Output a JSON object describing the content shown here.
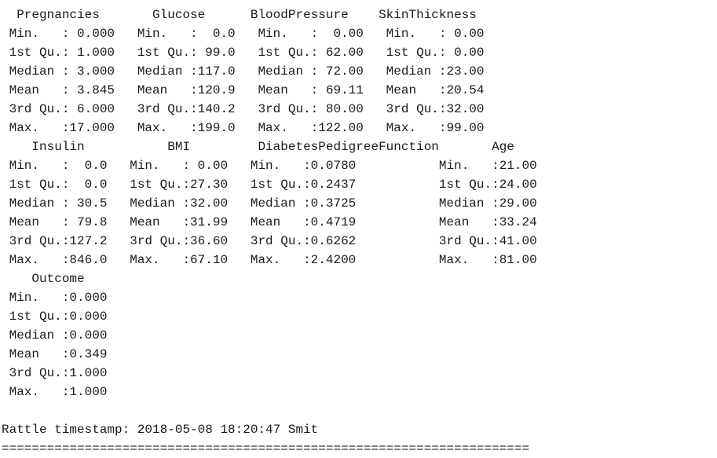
{
  "summary_blocks": [
    {
      "header": "  Pregnancies       Glucose      BloodPressure    SkinThickness",
      "rows": [
        " Min.   : 0.000   Min.   :  0.0   Min.   :  0.00   Min.   : 0.00",
        " 1st Qu.: 1.000   1st Qu.: 99.0   1st Qu.: 62.00   1st Qu.: 0.00",
        " Median : 3.000   Median :117.0   Median : 72.00   Median :23.00",
        " Mean   : 3.845   Mean   :120.9   Mean   : 69.11   Mean   :20.54",
        " 3rd Qu.: 6.000   3rd Qu.:140.2   3rd Qu.: 80.00   3rd Qu.:32.00",
        " Max.   :17.000   Max.   :199.0   Max.   :122.00   Max.   :99.00"
      ]
    },
    {
      "header": "    Insulin           BMI         DiabetesPedigreeFunction       Age",
      "rows": [
        " Min.   :  0.0   Min.   : 0.00   Min.   :0.0780           Min.   :21.00",
        " 1st Qu.:  0.0   1st Qu.:27.30   1st Qu.:0.2437           1st Qu.:24.00",
        " Median : 30.5   Median :32.00   Median :0.3725           Median :29.00",
        " Mean   : 79.8   Mean   :31.99   Mean   :0.4719           Mean   :33.24",
        " 3rd Qu.:127.2   3rd Qu.:36.60   3rd Qu.:0.6262           3rd Qu.:41.00",
        " Max.   :846.0   Max.   :67.10   Max.   :2.4200           Max.   :81.00"
      ]
    },
    {
      "header": "    Outcome",
      "rows": [
        " Min.   :0.000",
        " 1st Qu.:0.000",
        " Median :0.000",
        " Mean   :0.349",
        " 3rd Qu.:1.000",
        " Max.   :1.000"
      ]
    }
  ],
  "timestamp_line": "Rattle timestamp: 2018-05-08 18:20:47 Smit",
  "separator_line": "======================================================================"
}
